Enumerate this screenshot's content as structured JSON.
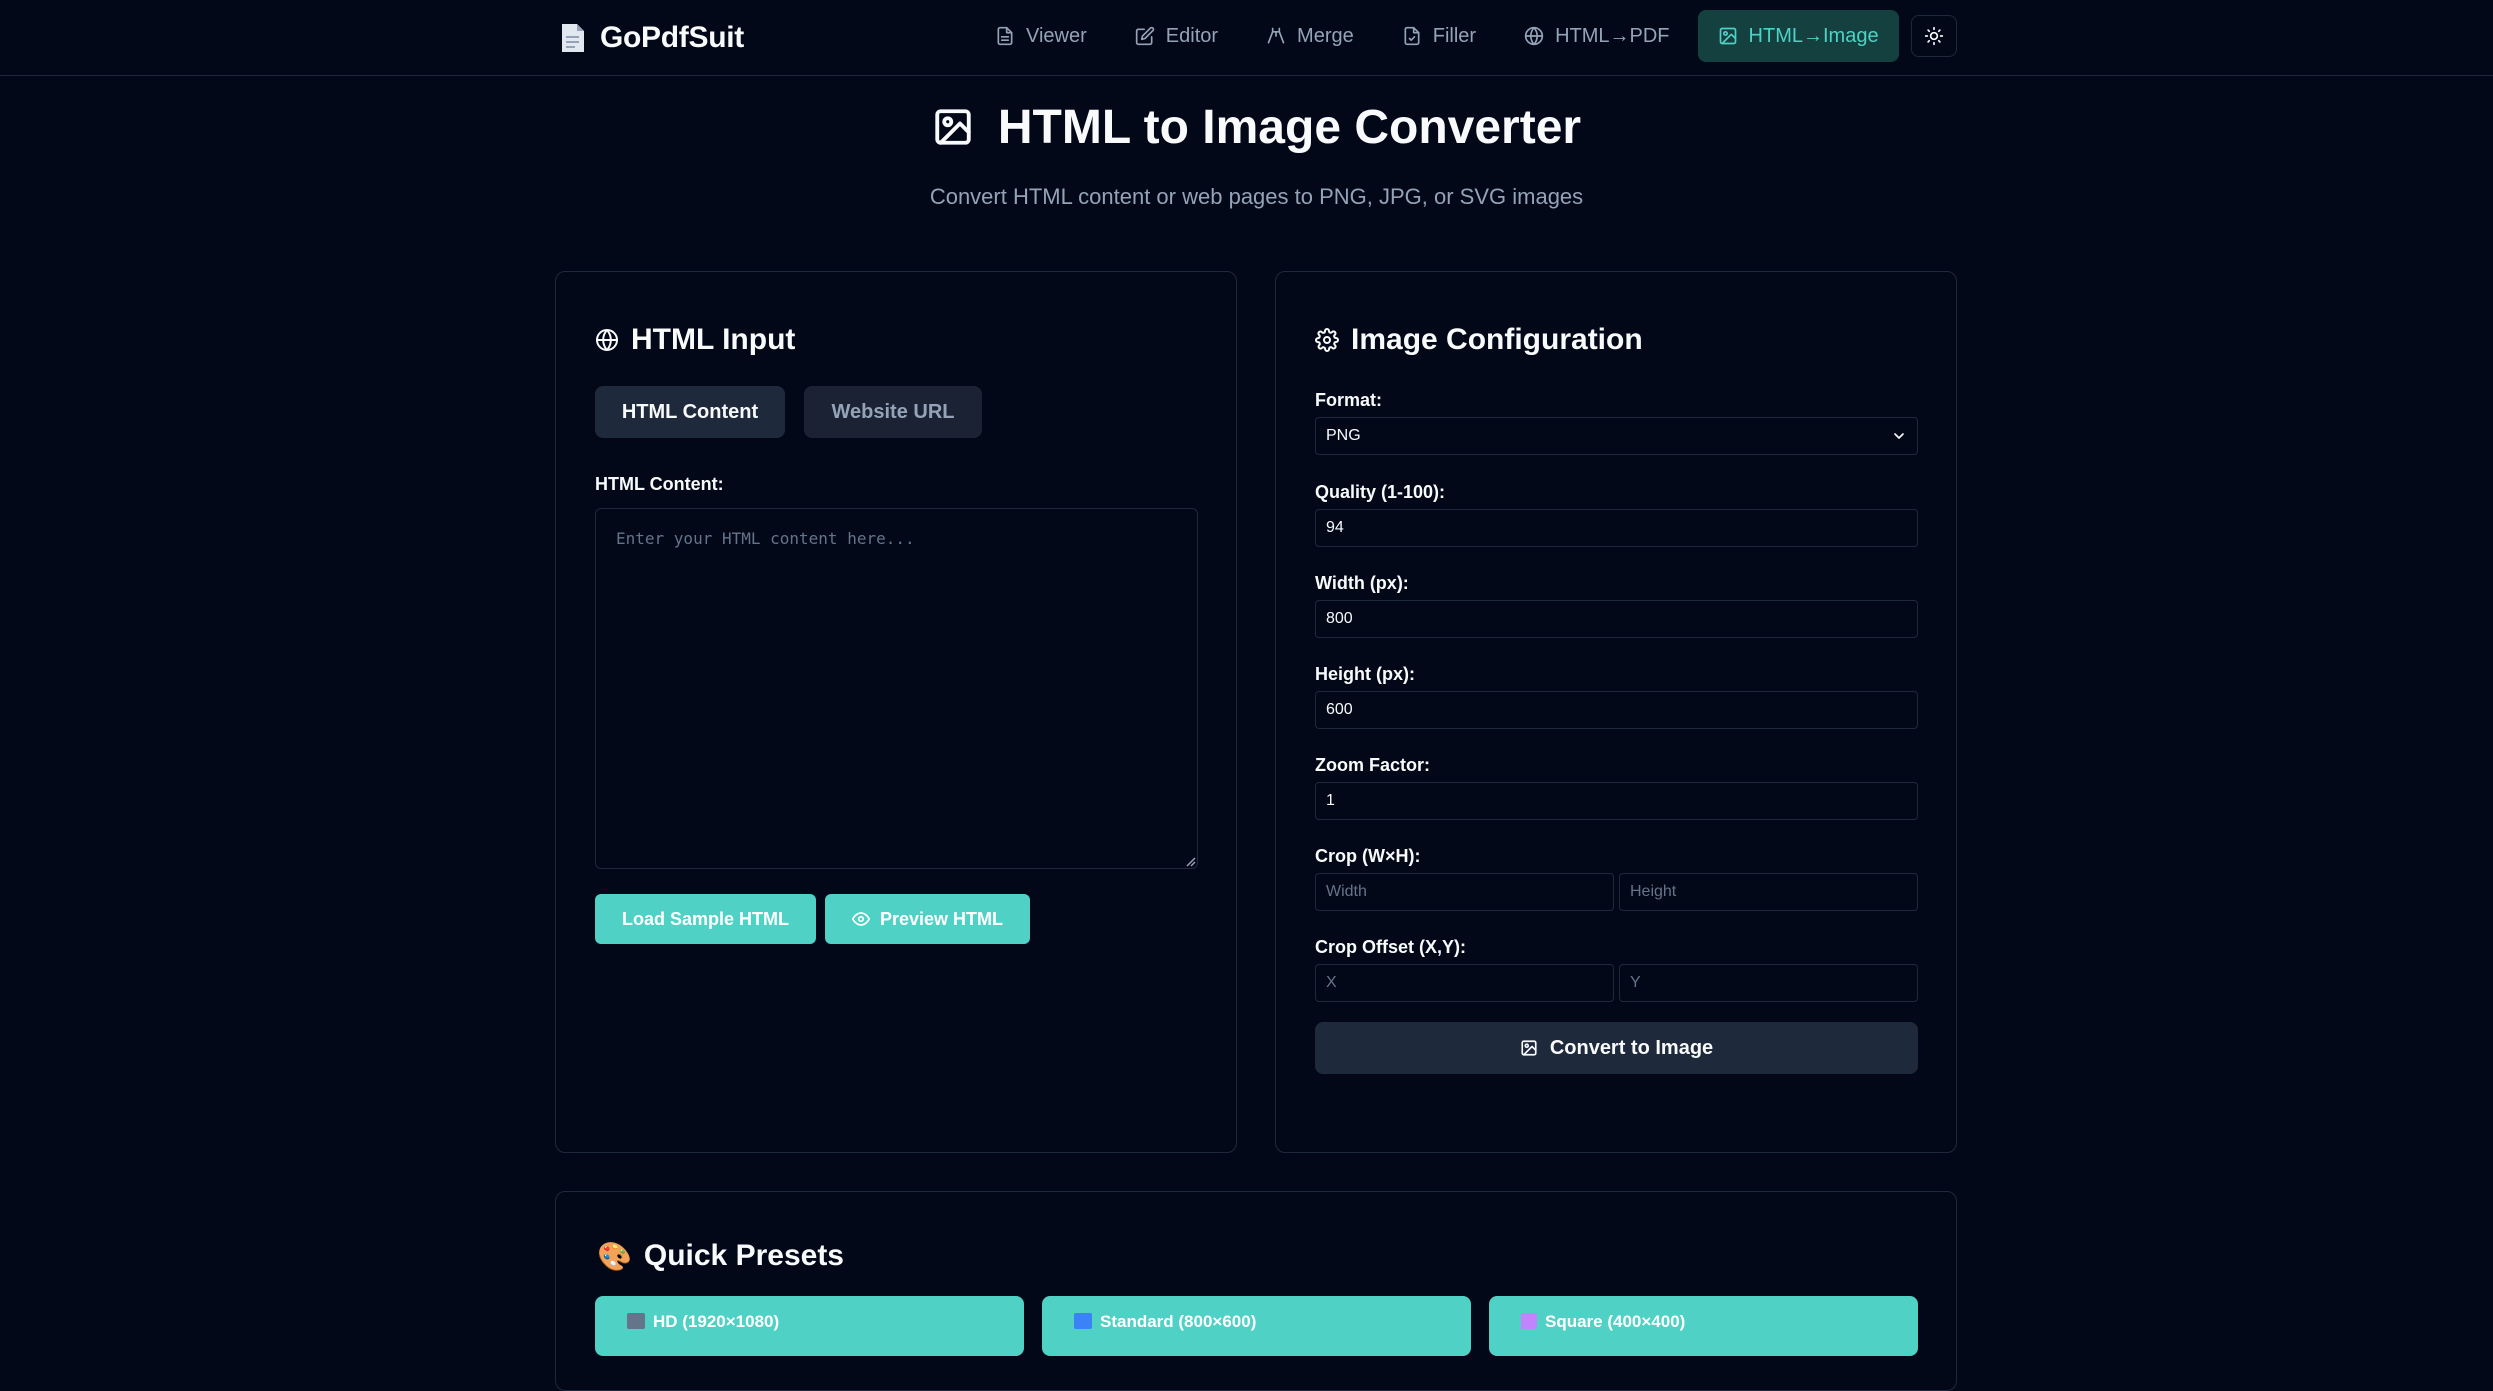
{
  "app": {
    "brand": "GoPdfSuit",
    "nav": [
      {
        "label": "Viewer",
        "icon": "file-text-icon"
      },
      {
        "label": "Editor",
        "icon": "edit-icon"
      },
      {
        "label": "Merge",
        "icon": "merge-icon"
      },
      {
        "label": "Filler",
        "icon": "file-check-icon"
      },
      {
        "label": "HTML→PDF",
        "icon": "globe-icon"
      },
      {
        "label": "HTML→Image",
        "icon": "image-icon",
        "active": true
      }
    ],
    "theme_toggle_icon": "sun-icon"
  },
  "header": {
    "title": "HTML to Image Converter",
    "subtitle": "Convert HTML content or web pages to PNG, JPG, or SVG images"
  },
  "html_input": {
    "heading": "HTML Input",
    "tabs": [
      {
        "label": "HTML Content",
        "active": true
      },
      {
        "label": "Website URL",
        "active": false
      }
    ],
    "content_label": "HTML Content:",
    "content_placeholder": "Enter your HTML content here...",
    "content_value": "",
    "load_sample_label": "Load Sample HTML",
    "preview_label": "Preview HTML"
  },
  "config": {
    "heading": "Image Configuration",
    "format_label": "Format:",
    "format_value": "PNG",
    "quality_label": "Quality (1-100):",
    "quality_value": "94",
    "width_label": "Width (px):",
    "width_value": "800",
    "height_label": "Height (px):",
    "height_value": "600",
    "zoom_label": "Zoom Factor:",
    "zoom_value": "1",
    "crop_label": "Crop (W×H):",
    "crop_width_placeholder": "Width",
    "crop_height_placeholder": "Height",
    "offset_label": "Crop Offset (X,Y):",
    "offset_x_placeholder": "X",
    "offset_y_placeholder": "Y",
    "convert_label": "Convert to Image"
  },
  "presets": {
    "heading": "Quick Presets",
    "heading_emoji": "🎨",
    "items": [
      {
        "label": "HD (1920×1080)",
        "icon": "monitor-icon"
      },
      {
        "label": "Standard (800×600)",
        "icon": "desktop-icon"
      },
      {
        "label": "Square (400×400)",
        "icon": "square-icon"
      }
    ]
  },
  "colors": {
    "background": "#020817",
    "accent": "#4fd1c5",
    "card_border": "#1e293b",
    "muted_text": "#94a3b8"
  }
}
